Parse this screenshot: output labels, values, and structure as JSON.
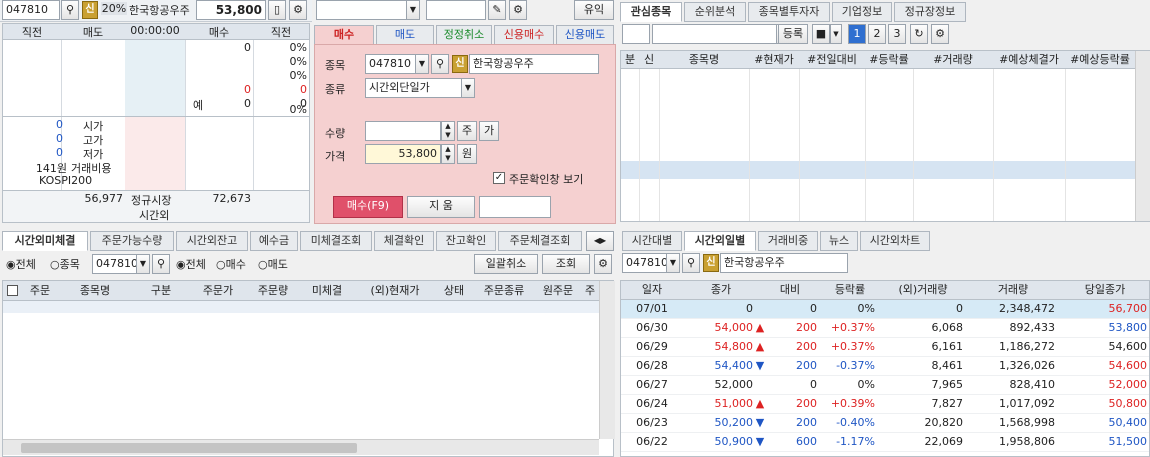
{
  "top_left": {
    "code": "047810",
    "sin": "신",
    "pct": "20%",
    "name": "한국항공우주",
    "price": "53,800"
  },
  "hoga": {
    "headers": [
      "직전",
      "매도",
      "00:00:00",
      "매수",
      "직전"
    ],
    "bid_right": [
      {
        "a": "0",
        "b": "0%"
      },
      {
        "a": "",
        "b": "0%"
      },
      {
        "a": "",
        "b": "0%"
      },
      {
        "a": "0",
        "b": "0"
      },
      {
        "a": "0",
        "b": "0"
      },
      {
        "a": "",
        "b": "0%"
      }
    ],
    "ye_label": "예",
    "stats": [
      {
        "v": "0",
        "l": "시가"
      },
      {
        "v": "0",
        "l": "고가"
      },
      {
        "v": "0",
        "l": "저가"
      },
      {
        "v": "141원",
        "l": "거래비용"
      },
      {
        "v": "",
        "l": "KOSPI200"
      }
    ],
    "bottom_left": "56,977",
    "regular_label": "정규시장",
    "regular_value": "72,673",
    "afterhours_label": "시간외"
  },
  "order_panel": {
    "mid_top_btn": "유익",
    "tabs": [
      "매수",
      "매도",
      "정정취소",
      "신용매수",
      "신용매도"
    ],
    "stock_label": "종목",
    "stock_code": "047810",
    "stock_name": "한국항공우주",
    "type_label": "종류",
    "type_value": "시간외단일가",
    "qty_label": "수량",
    "qty_btn1": "주",
    "qty_btn2": "가",
    "price_label": "가격",
    "price_value": "53,800",
    "price_unit": "원",
    "confirm_label": "주문확인창 보기",
    "buy_btn": "매수(F9)",
    "clear_btn": "지 움"
  },
  "right_top": {
    "tabs": [
      "관심종목",
      "순위분석",
      "종목별투자자",
      "기업정보",
      "정규장정보"
    ],
    "register_btn": "등록",
    "pages": [
      "1",
      "2",
      "3"
    ],
    "headers": [
      "분",
      "신",
      "종목명",
      "#현재가",
      "#전일대비",
      "#등락률",
      "#거래량",
      "#예상체결가",
      "#예상등락률"
    ]
  },
  "bottom_left": {
    "tabs": [
      "시간외미체결",
      "주문가능수량",
      "시간외잔고",
      "예수금",
      "미체결조회",
      "체결확인",
      "잔고확인",
      "주문체결조회"
    ],
    "radio1": [
      "전체",
      "종목"
    ],
    "code": "047810",
    "radio2": [
      "전체",
      "매수",
      "매도"
    ],
    "cancel_all_btn": "일괄취소",
    "query_btn": "조회",
    "headers": [
      "주문",
      "종목명",
      "구분",
      "주문가",
      "주문량",
      "미체결",
      "(외)현재가",
      "상태",
      "주문종류",
      "원주문",
      "주"
    ]
  },
  "bottom_right": {
    "tabs": [
      "시간대별",
      "시간외일별",
      "거래비중",
      "뉴스",
      "시간외차트"
    ],
    "code": "047810",
    "stock_name": "한국항공우주",
    "headers": [
      "일자",
      "종가",
      "대비",
      "등락률",
      "(외)거래량",
      "거래량",
      "당일종가"
    ],
    "rows": [
      {
        "date": "07/01",
        "close": "0",
        "dir": "",
        "diff": "0",
        "rate": "0%",
        "ovol": "0",
        "vol": "2,348,472",
        "dayclose": "56,700",
        "cc": "",
        "dc": "up"
      },
      {
        "date": "06/30",
        "close": "54,000",
        "dir": "▲",
        "diff": "200",
        "rate": "+0.37%",
        "ovol": "6,068",
        "vol": "892,433",
        "dayclose": "53,800",
        "cc": "up",
        "dc": "dn"
      },
      {
        "date": "06/29",
        "close": "54,800",
        "dir": "▲",
        "diff": "200",
        "rate": "+0.37%",
        "ovol": "6,161",
        "vol": "1,186,272",
        "dayclose": "54,600",
        "cc": "up",
        "dc": ""
      },
      {
        "date": "06/28",
        "close": "54,400",
        "dir": "▼",
        "diff": "200",
        "rate": "-0.37%",
        "ovol": "8,461",
        "vol": "1,326,026",
        "dayclose": "54,600",
        "cc": "dn",
        "dc": "up"
      },
      {
        "date": "06/27",
        "close": "52,000",
        "dir": "",
        "diff": "0",
        "rate": "0%",
        "ovol": "7,965",
        "vol": "828,410",
        "dayclose": "52,000",
        "cc": "",
        "dc": "up"
      },
      {
        "date": "06/24",
        "close": "51,000",
        "dir": "▲",
        "diff": "200",
        "rate": "+0.39%",
        "ovol": "7,827",
        "vol": "1,017,092",
        "dayclose": "50,800",
        "cc": "up",
        "dc": "up"
      },
      {
        "date": "06/23",
        "close": "50,200",
        "dir": "▼",
        "diff": "200",
        "rate": "-0.40%",
        "ovol": "20,820",
        "vol": "1,568,998",
        "dayclose": "50,400",
        "cc": "dn",
        "dc": "dn"
      },
      {
        "date": "06/22",
        "close": "50,900",
        "dir": "▼",
        "diff": "600",
        "rate": "-1.17%",
        "ovol": "22,069",
        "vol": "1,958,806",
        "dayclose": "51,500",
        "cc": "dn",
        "dc": "dn"
      }
    ]
  }
}
